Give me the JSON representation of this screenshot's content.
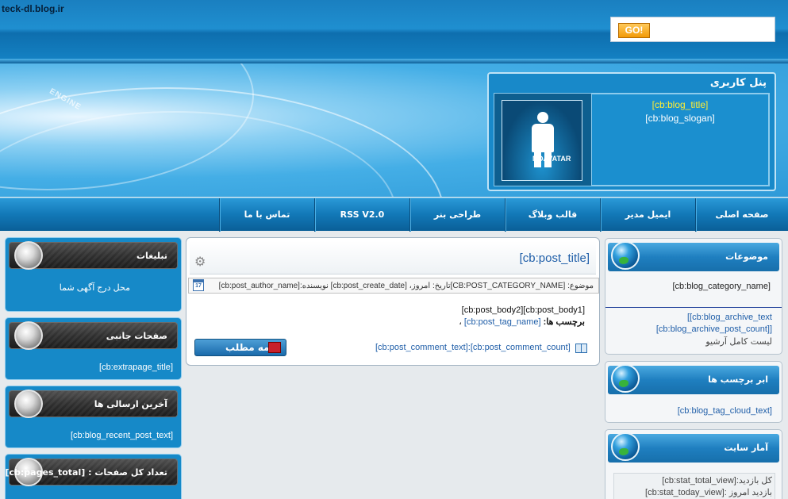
{
  "site": {
    "url": "teck-dl.blog.ir"
  },
  "search": {
    "button": "GO!",
    "placeholder": ""
  },
  "banner": {
    "decor_text": "ENGINE"
  },
  "user_panel": {
    "title": "پنل کاربری",
    "avatar_label": "NOAVATAR",
    "blog_title": "[cb:blog_title]",
    "blog_slogan": "[cb:blog_slogan]"
  },
  "nav": {
    "items": [
      {
        "label": "صفحه اصلی"
      },
      {
        "label": "ایمیل مدیر"
      },
      {
        "label": "قالب وبلاگ"
      },
      {
        "label": "طراحی بنر"
      },
      {
        "label": "RSS V2.0"
      },
      {
        "label": "تماس با ما"
      }
    ]
  },
  "right_sidebar": {
    "categories": {
      "title": "موضوعات",
      "item": "[cb:blog_category_name]"
    },
    "archive": {
      "line1": "[[cb:blog_archive_text",
      "line2": "[cb:blog_archive_post_count]]",
      "line3": "لیست کامل آرشیو"
    },
    "tags": {
      "title": "ابر برچسب ها",
      "item": "[cb:blog_tag_cloud_text]"
    },
    "stats": {
      "title": "آمار سایت",
      "total": "کل بازدید:[cb:stat_total_view]",
      "today": "بازدید امروز :[cb:stat_today_view]"
    }
  },
  "post": {
    "title": "[cb:post_title]",
    "meta": "موضوع: [CB:POST_CATEGORY_NAME]تاریخ: امروز، [cb:post_create_date] نویسنده:[cb:post_author_name]",
    "calendar_day": "17",
    "body_line1": "[cb:post_body1][cb:post_body2]",
    "tags_label": "برچسب ها:",
    "tags_value": "[cb:post_tag_name]",
    "tags_suffix": "،",
    "more_button": "ادامه مطلب",
    "comments": "[cb:post_comment_text]:[cb:post_comment_count]"
  },
  "left_sidebar": {
    "ads": {
      "title": "تبلیغات",
      "body": "محل درج آگهی شما"
    },
    "pages": {
      "title": "صفحات جانبی",
      "body": "[cb:extrapage_title]"
    },
    "recent": {
      "title": "آخرین ارسالی ها",
      "body": "[cb:blog_recent_post_text]"
    },
    "total": {
      "title": "تعداد کل صفحات : [cb:pages_total]"
    }
  }
}
